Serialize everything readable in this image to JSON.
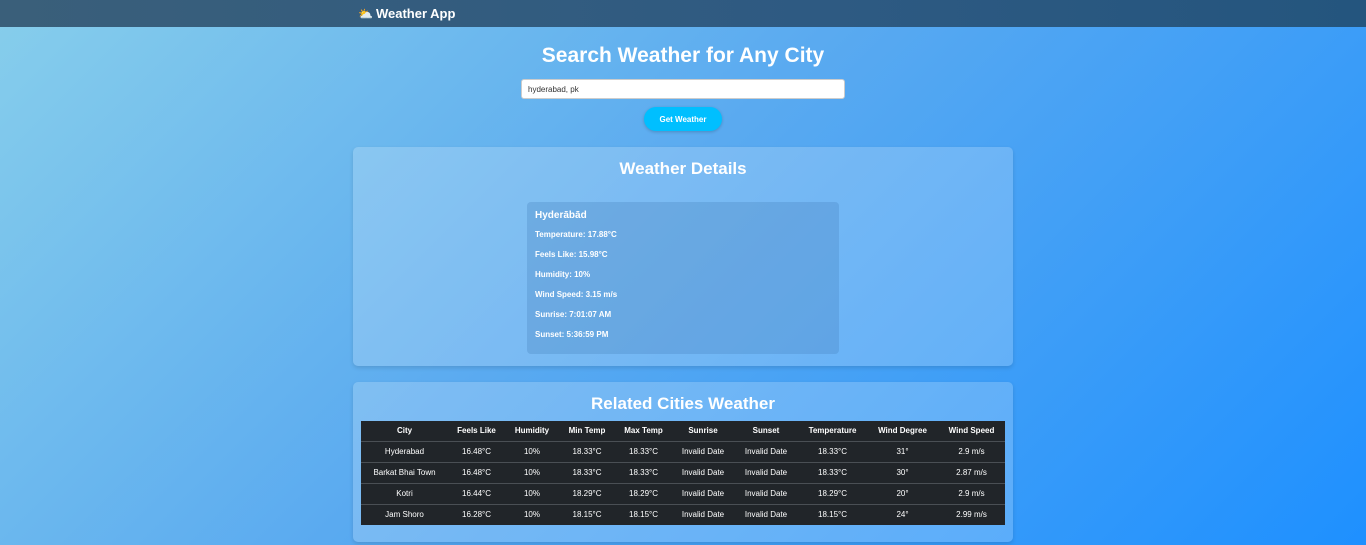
{
  "navbar": {
    "brand_icon": "⛅",
    "brand_text": "Weather App"
  },
  "search": {
    "title": "Search Weather for Any City",
    "input_value": "hyderabad, pk",
    "button_label": "Get Weather"
  },
  "details": {
    "title": "Weather Details",
    "city": "Hyderābād",
    "lines": [
      "Temperature: 17.88°C",
      "Feels Like: 15.98°C",
      "Humidity: 10%",
      "Wind Speed: 3.15 m/s",
      "Sunrise: 7:01:07 AM",
      "Sunset: 5:36:59 PM"
    ]
  },
  "related": {
    "title": "Related Cities Weather",
    "headers": [
      "City",
      "Feels Like",
      "Humidity",
      "Min Temp",
      "Max Temp",
      "Sunrise",
      "Sunset",
      "Temperature",
      "Wind Degree",
      "Wind Speed"
    ],
    "rows": [
      [
        "Hyderabad",
        "16.48°C",
        "10%",
        "18.33°C",
        "18.33°C",
        "Invalid Date",
        "Invalid Date",
        "18.33°C",
        "31°",
        "2.9 m/s"
      ],
      [
        "Barkat Bhai Town",
        "16.48°C",
        "10%",
        "18.33°C",
        "18.33°C",
        "Invalid Date",
        "Invalid Date",
        "18.33°C",
        "30°",
        "2.87 m/s"
      ],
      [
        "Kotri",
        "16.44°C",
        "10%",
        "18.29°C",
        "18.29°C",
        "Invalid Date",
        "Invalid Date",
        "18.29°C",
        "20°",
        "2.9 m/s"
      ],
      [
        "Jam Shoro",
        "16.28°C",
        "10%",
        "18.15°C",
        "18.15°C",
        "Invalid Date",
        "Invalid Date",
        "18.15°C",
        "24°",
        "2.99 m/s"
      ]
    ]
  }
}
